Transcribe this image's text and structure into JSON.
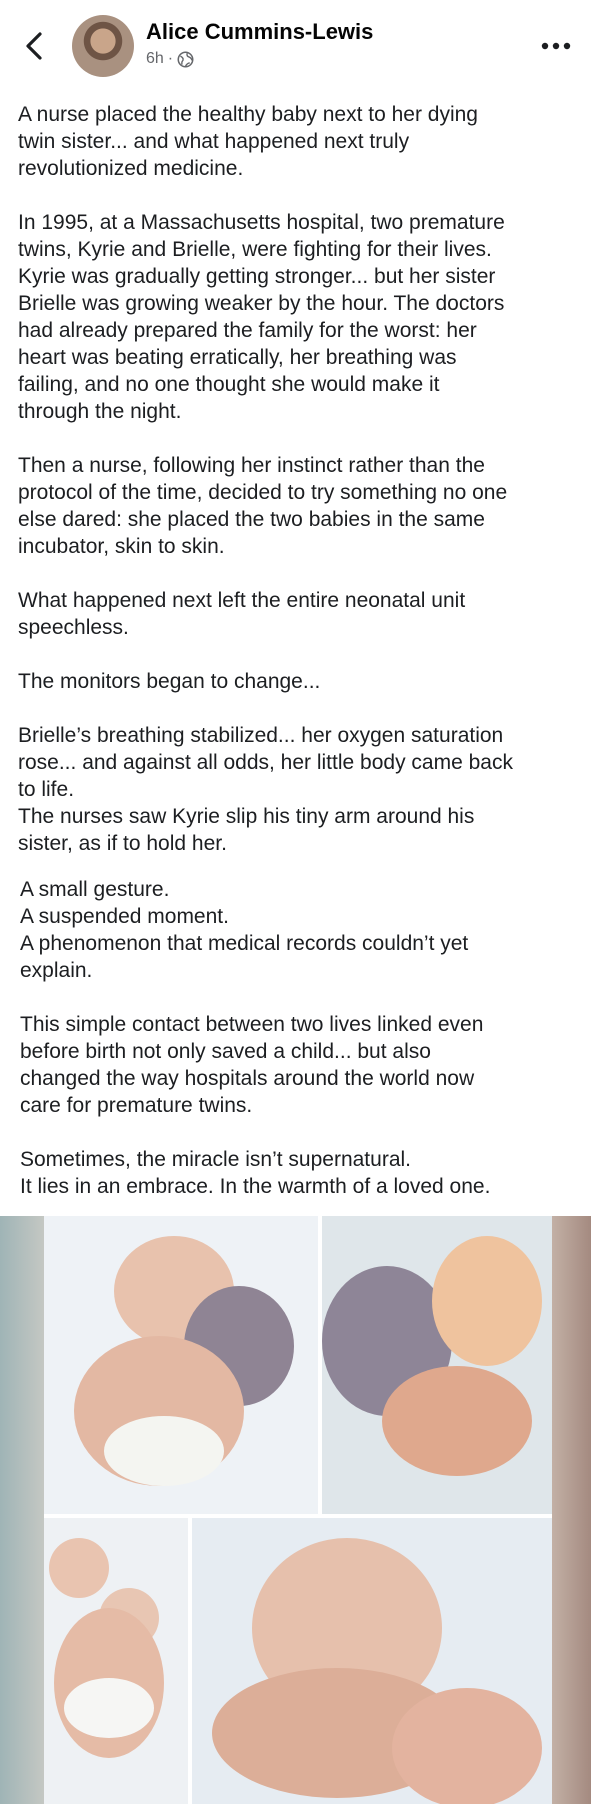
{
  "post": {
    "author": "Alice Cummins-Lewis",
    "time": "6h",
    "separator": "·",
    "audience_icon": "globe-icon",
    "paragraphs": [
      "A nurse placed the healthy baby next to her dying\ntwin sister... and what happened next truly\nrevolutionized medicine.",
      "In 1995, at a Massachusetts hospital, two premature\ntwins, Kyrie and Brielle, were fighting for their lives.\nKyrie was gradually getting stronger... but her sister\nBrielle was growing weaker by the hour. The doctors\nhad already prepared the family for the worst: her\nheart was beating erratically, her breathing was\nfailing, and no one thought she would make it\nthrough the night.",
      "Then a nurse, following her instinct rather than the\nprotocol of the time, decided to try something no one\nelse dared: she placed the two babies in the same\nincubator, skin to skin.",
      "What happened next left the entire neonatal unit\nspeechless.",
      "The monitors began to change...",
      "Brielle’s breathing stabilized... her oxygen saturation\nrose... and against all odds, her little body came back\nto life.\nThe nurses saw Kyrie slip his tiny arm around his\nsister, as if to hold her."
    ],
    "paragraphs_2": [
      "A small gesture.\nA suspended moment.\nA phenomenon that medical records couldn’t yet\nexplain.",
      "This simple contact between two lives linked even\nbefore birth not only saved a child... but also\nchanged the way hospitals around the world now\ncare for premature twins.",
      "Sometimes, the miracle isn’t supernatural.\nIt lies in an embrace. In the warmth of a loved one."
    ]
  },
  "icons": {
    "back": "chevron-left-icon",
    "more": "more-horizontal-icon",
    "audience": "globe-icon"
  },
  "colors": {
    "text": "#1c1e21",
    "secondary": "#65676b",
    "background": "#ffffff"
  }
}
